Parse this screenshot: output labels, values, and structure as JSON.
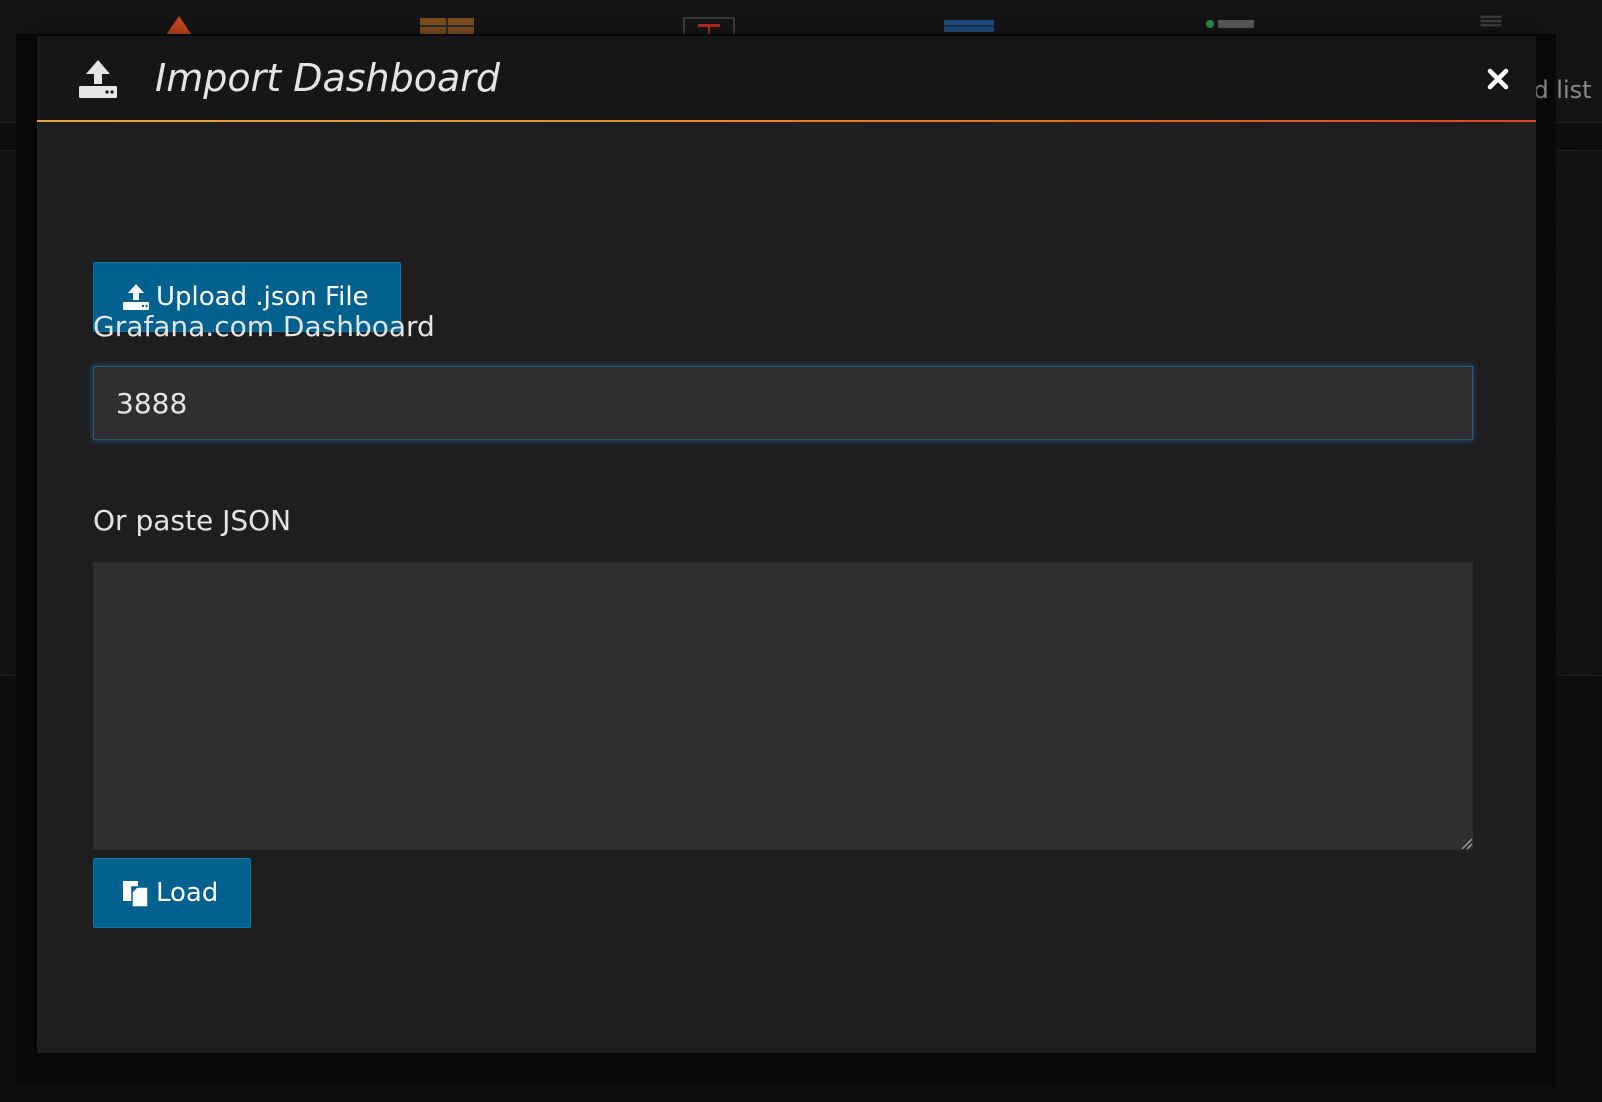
{
  "background": {
    "partial_label": "rd list"
  },
  "modal": {
    "title": "Import Dashboard",
    "icon": "upload-icon",
    "close_icon": "close-icon"
  },
  "upload": {
    "label": "Upload .json File",
    "icon": "upload-icon"
  },
  "grafana_com": {
    "label": "Grafana.com Dashboard",
    "value": "3888",
    "placeholder": ""
  },
  "paste_json": {
    "label": "Or paste JSON",
    "value": ""
  },
  "load": {
    "label": "Load",
    "icon": "copy-icon"
  },
  "colors": {
    "accent_button": "#00618f",
    "modal_bg": "#1e1e20",
    "header_bg": "#161618",
    "header_rule_start": "#e9a53a",
    "header_rule_end": "#e3431e",
    "input_bg": "#2f2f31",
    "focus_glow": "#3392c8",
    "text": "#e4e4e4"
  }
}
